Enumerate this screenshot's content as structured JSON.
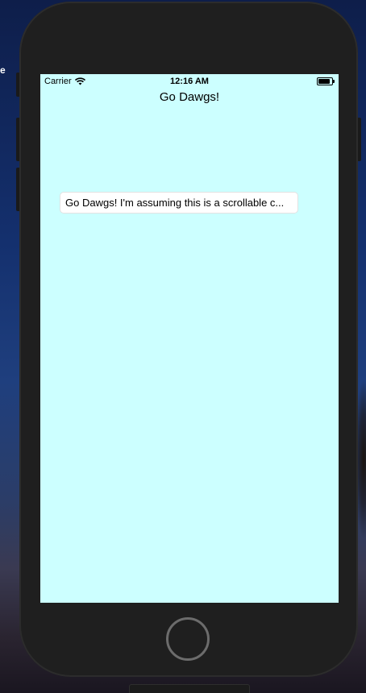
{
  "desktop": {
    "edge_text": "e"
  },
  "status_bar": {
    "carrier": "Carrier",
    "time": "12:16 AM",
    "wifi_icon": "wifi-icon",
    "battery_icon": "battery-icon",
    "battery_level": 1.0
  },
  "nav": {
    "title": "Go Dawgs!"
  },
  "text_field": {
    "value": "Go Dawgs! I'm assuming this is a scrollable c..."
  },
  "device": {
    "home_button_icon": "home-button",
    "screen_color": "#ccffff",
    "frame_color": "#1f1f1f"
  }
}
